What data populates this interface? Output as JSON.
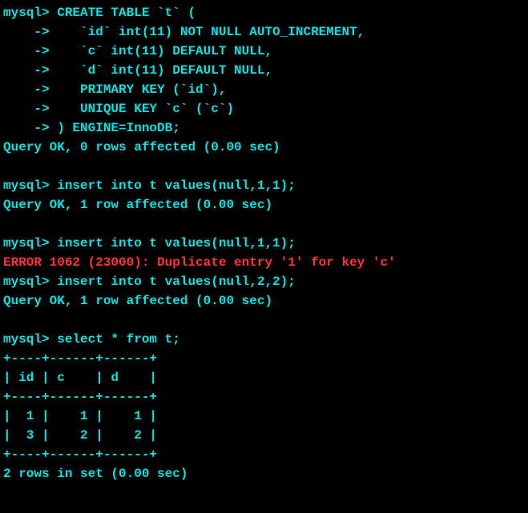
{
  "lines": [
    {
      "text": "mysql> CREATE TABLE `t` (",
      "cls": "line"
    },
    {
      "text": "    ->    `id` int(11) NOT NULL AUTO_INCREMENT,",
      "cls": "line"
    },
    {
      "text": "    ->    `c` int(11) DEFAULT NULL,",
      "cls": "line"
    },
    {
      "text": "    ->    `d` int(11) DEFAULT NULL,",
      "cls": "line"
    },
    {
      "text": "    ->    PRIMARY KEY (`id`),",
      "cls": "line"
    },
    {
      "text": "    ->    UNIQUE KEY `c` (`c`)",
      "cls": "line"
    },
    {
      "text": "    -> ) ENGINE=InnoDB;",
      "cls": "line"
    },
    {
      "text": "Query OK, 0 rows affected (0.00 sec)",
      "cls": "line"
    },
    {
      "text": "",
      "cls": "blank"
    },
    {
      "text": "mysql> insert into t values(null,1,1);",
      "cls": "line"
    },
    {
      "text": "Query OK, 1 row affected (0.00 sec)",
      "cls": "line"
    },
    {
      "text": "",
      "cls": "blank"
    },
    {
      "text": "mysql> insert into t values(null,1,1);",
      "cls": "line"
    },
    {
      "text": "ERROR 1062 (23000): Duplicate entry '1' for key 'c'",
      "cls": "error"
    },
    {
      "text": "mysql> insert into t values(null,2,2);",
      "cls": "line"
    },
    {
      "text": "Query OK, 1 row affected (0.00 sec)",
      "cls": "line"
    },
    {
      "text": "",
      "cls": "blank"
    },
    {
      "text": "mysql> select * from t;",
      "cls": "line"
    },
    {
      "text": "+----+------+------+",
      "cls": "line"
    },
    {
      "text": "| id | c    | d    |",
      "cls": "line"
    },
    {
      "text": "+----+------+------+",
      "cls": "line"
    },
    {
      "text": "|  1 |    1 |    1 |",
      "cls": "line"
    },
    {
      "text": "|  3 |    2 |    2 |",
      "cls": "line"
    },
    {
      "text": "+----+------+------+",
      "cls": "line"
    },
    {
      "text": "2 rows in set (0.00 sec)",
      "cls": "line"
    }
  ],
  "chart_data": {
    "type": "table",
    "title": "select * from t",
    "columns": [
      "id",
      "c",
      "d"
    ],
    "rows": [
      {
        "id": 1,
        "c": 1,
        "d": 1
      },
      {
        "id": 3,
        "c": 2,
        "d": 2
      }
    ],
    "row_count": 2,
    "time_sec": 0.0
  }
}
